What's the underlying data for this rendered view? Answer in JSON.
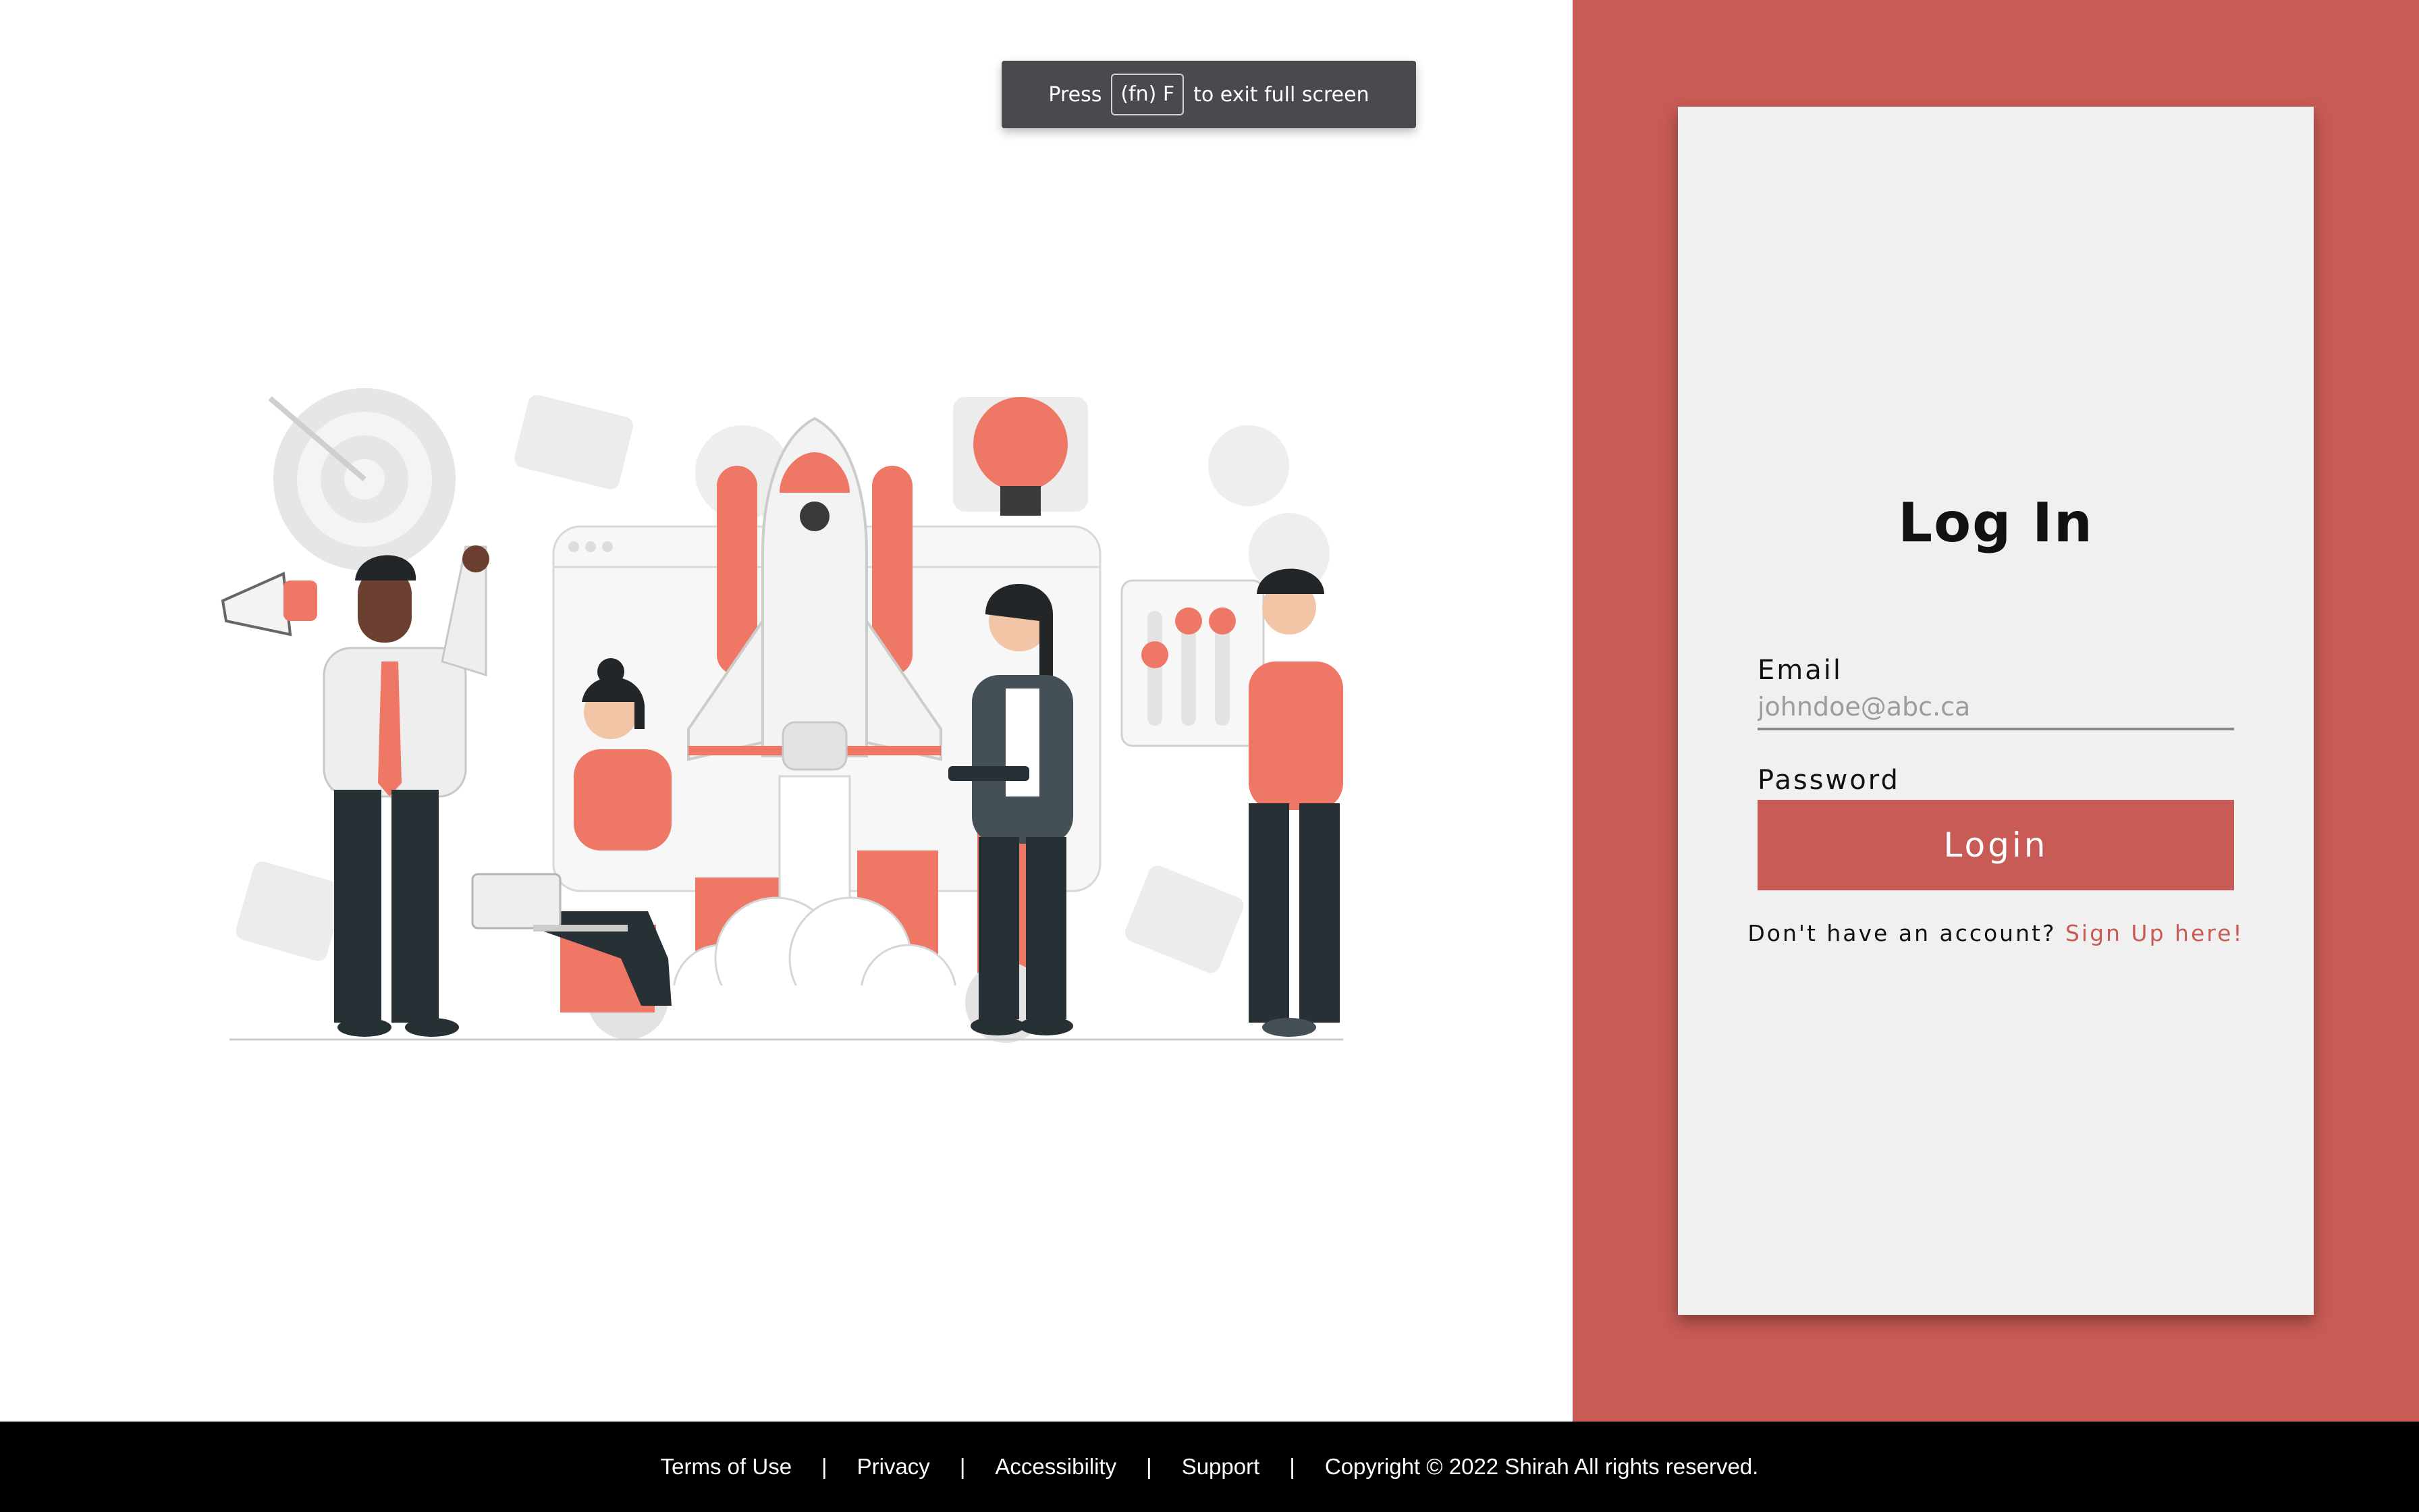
{
  "fullscreen_hint": {
    "press": "Press",
    "key": "(fn) F",
    "suffix": "to exit full screen"
  },
  "login": {
    "title": "Log In",
    "email_label": "Email",
    "email_placeholder": "johndoe@abc.ca",
    "password_label": "Password",
    "password_mask": "●●●●●●●●●",
    "submit_label": "Login",
    "signup_prompt": "Don't have an account?",
    "signup_link": "Sign Up here!"
  },
  "footer": {
    "links": [
      "Terms of Use",
      "Privacy",
      "Accessibility",
      "Support"
    ],
    "separator": "|",
    "copyright": "Copyright © 2022 Shirah All rights reserved."
  },
  "colors": {
    "accent": "#c85b55",
    "illustration_orange": "#ee7766",
    "card_bg": "#f0f0f0",
    "footer_bg": "#000000"
  }
}
